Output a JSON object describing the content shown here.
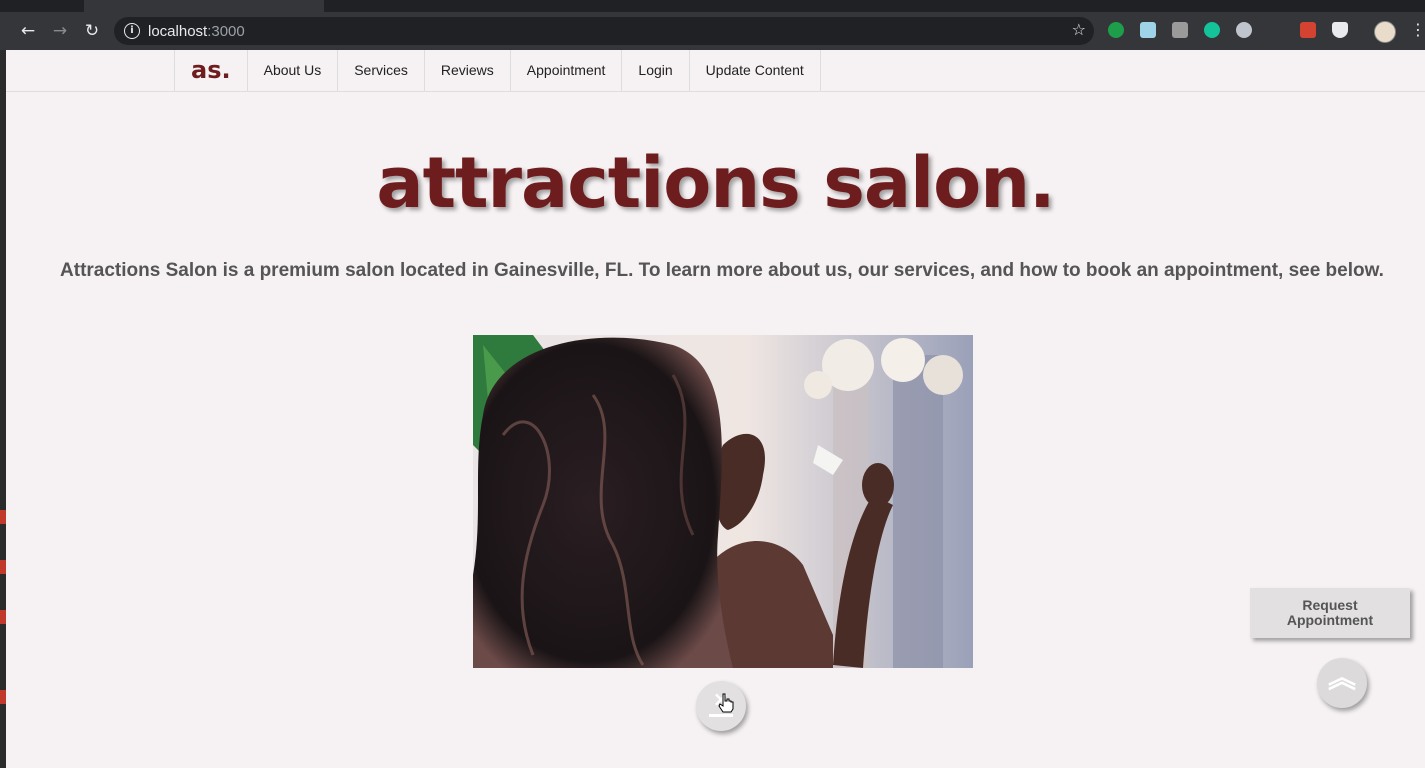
{
  "browser": {
    "url_host": "localhost",
    "url_port": ":3000",
    "back_icon": "←",
    "forward_icon": "→",
    "reload_icon": "↻",
    "info_icon": "i",
    "star_icon": "☆",
    "menu_icon": "⋮"
  },
  "nav": {
    "logo": "as.",
    "items": [
      {
        "label": "About Us"
      },
      {
        "label": "Services"
      },
      {
        "label": "Reviews"
      },
      {
        "label": "Appointment"
      },
      {
        "label": "Login"
      },
      {
        "label": "Update Content"
      }
    ]
  },
  "hero": {
    "title": "attractions salon.",
    "tagline": "Attractions Salon is a premium salon located in Gainesville, FL. To learn more about us, our services, and how to book an appointment, see below.",
    "photo_icon": "hero-photo"
  },
  "floating": {
    "request_line1": "Request",
    "request_line2": "Appointment",
    "scroll_down_icon": "×",
    "top_icon": "︽"
  },
  "colors": {
    "brand": "#6e1d1f",
    "page_bg": "#f6f2f3",
    "button_bg": "#e2e0e1"
  }
}
